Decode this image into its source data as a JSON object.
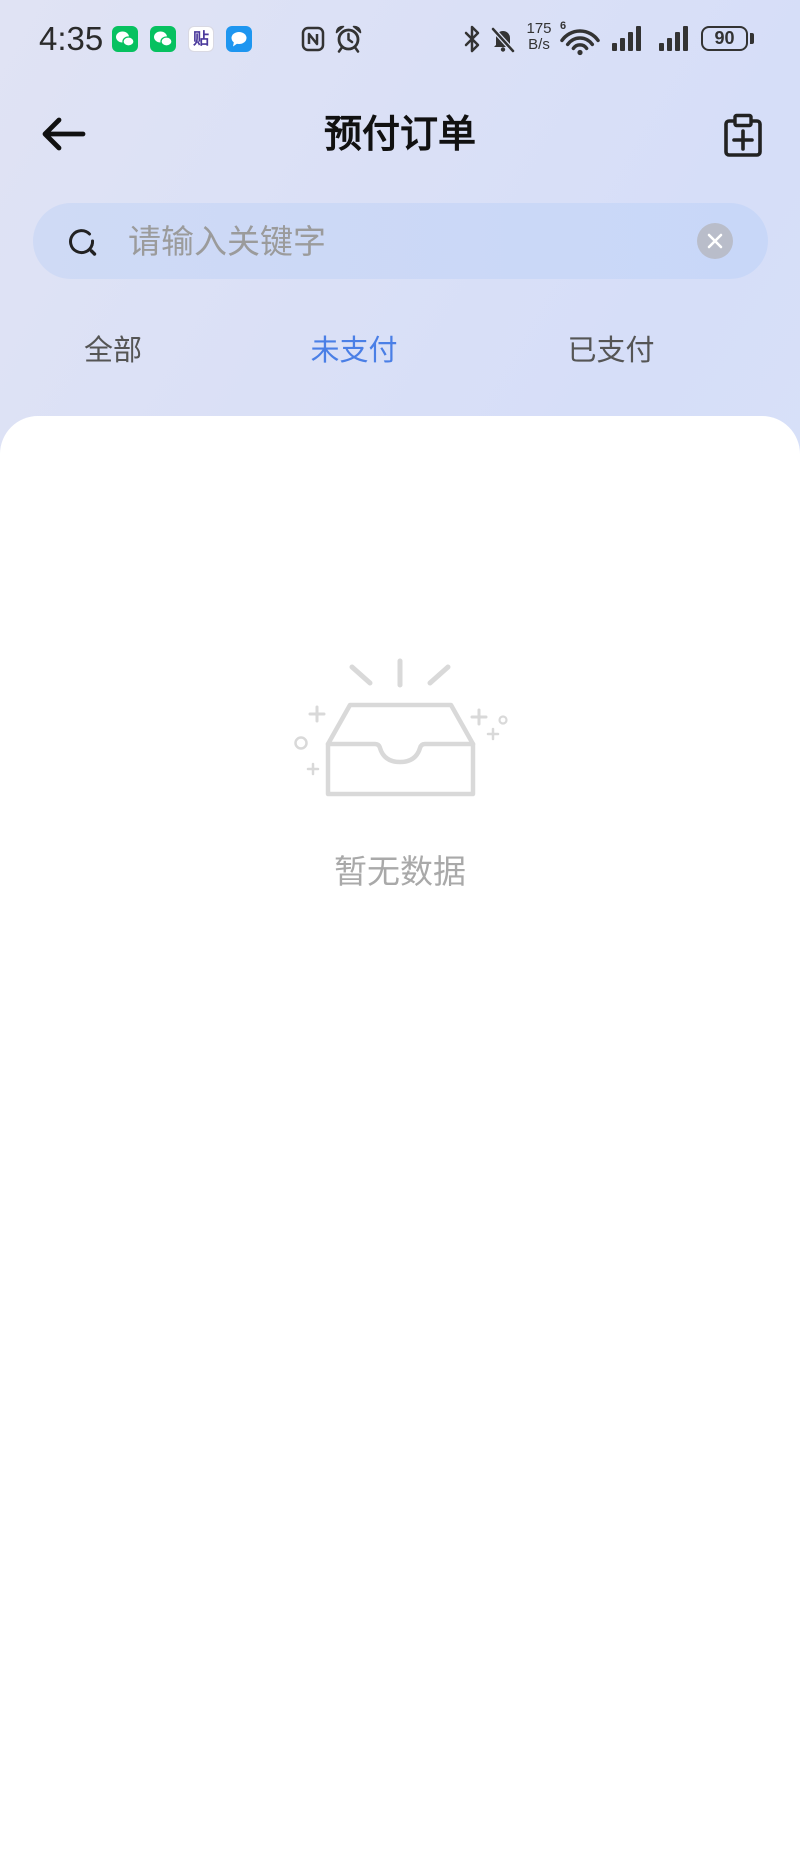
{
  "status_bar": {
    "time": "4:35",
    "notification_icons": [
      "wechat-icon",
      "wechat-icon",
      "tie-app-icon",
      "message-icon"
    ],
    "tie_app_glyph": "贴",
    "system_icons": [
      "nfc-icon",
      "alarm-icon",
      "bluetooth-icon",
      "mute-bell-icon",
      "wifi-icon",
      "signal-icon",
      "signal-icon",
      "battery-icon"
    ],
    "net_speed": {
      "value": "175",
      "unit": "B/s"
    },
    "wifi_generation": "6",
    "battery_level": "90"
  },
  "header": {
    "title": "预付订单",
    "left_icon": "back-arrow-icon",
    "right_icon": "clipboard-add-icon"
  },
  "search": {
    "placeholder": "请输入关键字",
    "value": "",
    "icon": "search-icon",
    "clear_icon": "clear-icon"
  },
  "tabs": [
    {
      "label": "全部",
      "active": false
    },
    {
      "label": "未支付",
      "active": true
    },
    {
      "label": "已支付",
      "active": false
    }
  ],
  "empty_state": {
    "icon": "empty-inbox-icon",
    "text": "暂无数据"
  },
  "colors": {
    "accent": "#4a7fe6",
    "tab_inactive": "#555555",
    "placeholder": "#9b9b9b",
    "empty_text": "#a9a9a9",
    "wechat": "#07c160",
    "message": "#1e96f0"
  }
}
